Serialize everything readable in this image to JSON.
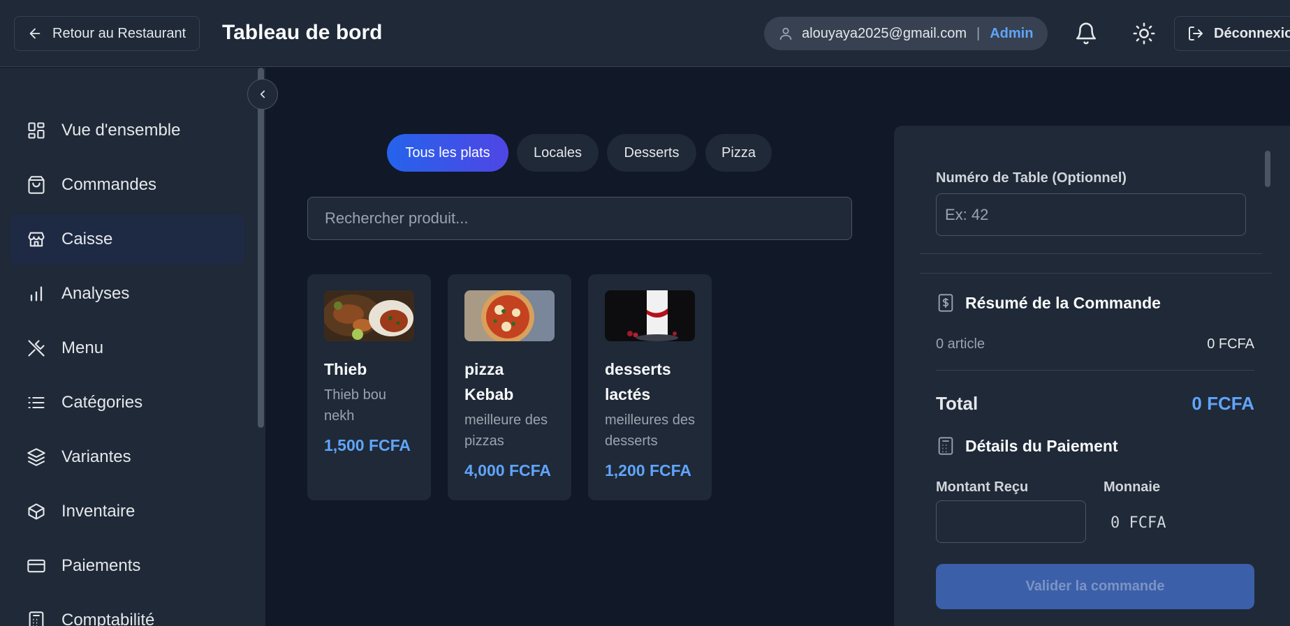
{
  "header": {
    "back_label": "Retour au Restaurant",
    "title": "Tableau de bord",
    "user_email": "alouyaya2025@gmail.com",
    "separator": "|",
    "user_role": "Admin",
    "logout_label": "Déconnexion"
  },
  "sidebar": {
    "items": [
      {
        "label": "Vue d'ensemble",
        "icon": "grid-icon"
      },
      {
        "label": "Commandes",
        "icon": "shopping-bag-icon"
      },
      {
        "label": "Caisse",
        "icon": "store-icon"
      },
      {
        "label": "Analyses",
        "icon": "bar-chart-icon"
      },
      {
        "label": "Menu",
        "icon": "utensils-icon"
      },
      {
        "label": "Catégories",
        "icon": "list-icon"
      },
      {
        "label": "Variantes",
        "icon": "layers-icon"
      },
      {
        "label": "Inventaire",
        "icon": "box-icon"
      },
      {
        "label": "Paiements",
        "icon": "credit-card-icon"
      },
      {
        "label": "Comptabilité",
        "icon": "calculator-icon"
      }
    ],
    "active": "Caisse"
  },
  "categories": [
    "Tous les plats",
    "Locales",
    "Desserts",
    "Pizza"
  ],
  "search": {
    "placeholder": "Rechercher produit..."
  },
  "products": [
    {
      "name": "Thieb",
      "description": "Thieb bou nekh",
      "price": "1,500 FCFA"
    },
    {
      "name": "pizza Kebab",
      "description": "meilleure des pizzas",
      "price": "4,000 FCFA"
    },
    {
      "name": "desserts lactés",
      "description": "meilleures des desserts",
      "price": "1,200 FCFA"
    }
  ],
  "order": {
    "table_label": "Numéro de Table (Optionnel)",
    "table_placeholder": "Ex: 42",
    "summary_title": "Résumé de la Commande",
    "item_count": "0 article",
    "item_amount": "0 FCFA",
    "total_label": "Total",
    "total_value": "0 FCFA",
    "payment_title": "Détails du Paiement",
    "received_label": "Montant Reçu",
    "change_label": "Monnaie",
    "change_value": "0 FCFA",
    "validate_label": "Valider la commande"
  },
  "colors": {
    "background": "#111827",
    "surface": "#1f2937",
    "accent": "#60a5fa",
    "active_gradient_start": "#2563eb",
    "active_gradient_end": "#4f46e5"
  }
}
